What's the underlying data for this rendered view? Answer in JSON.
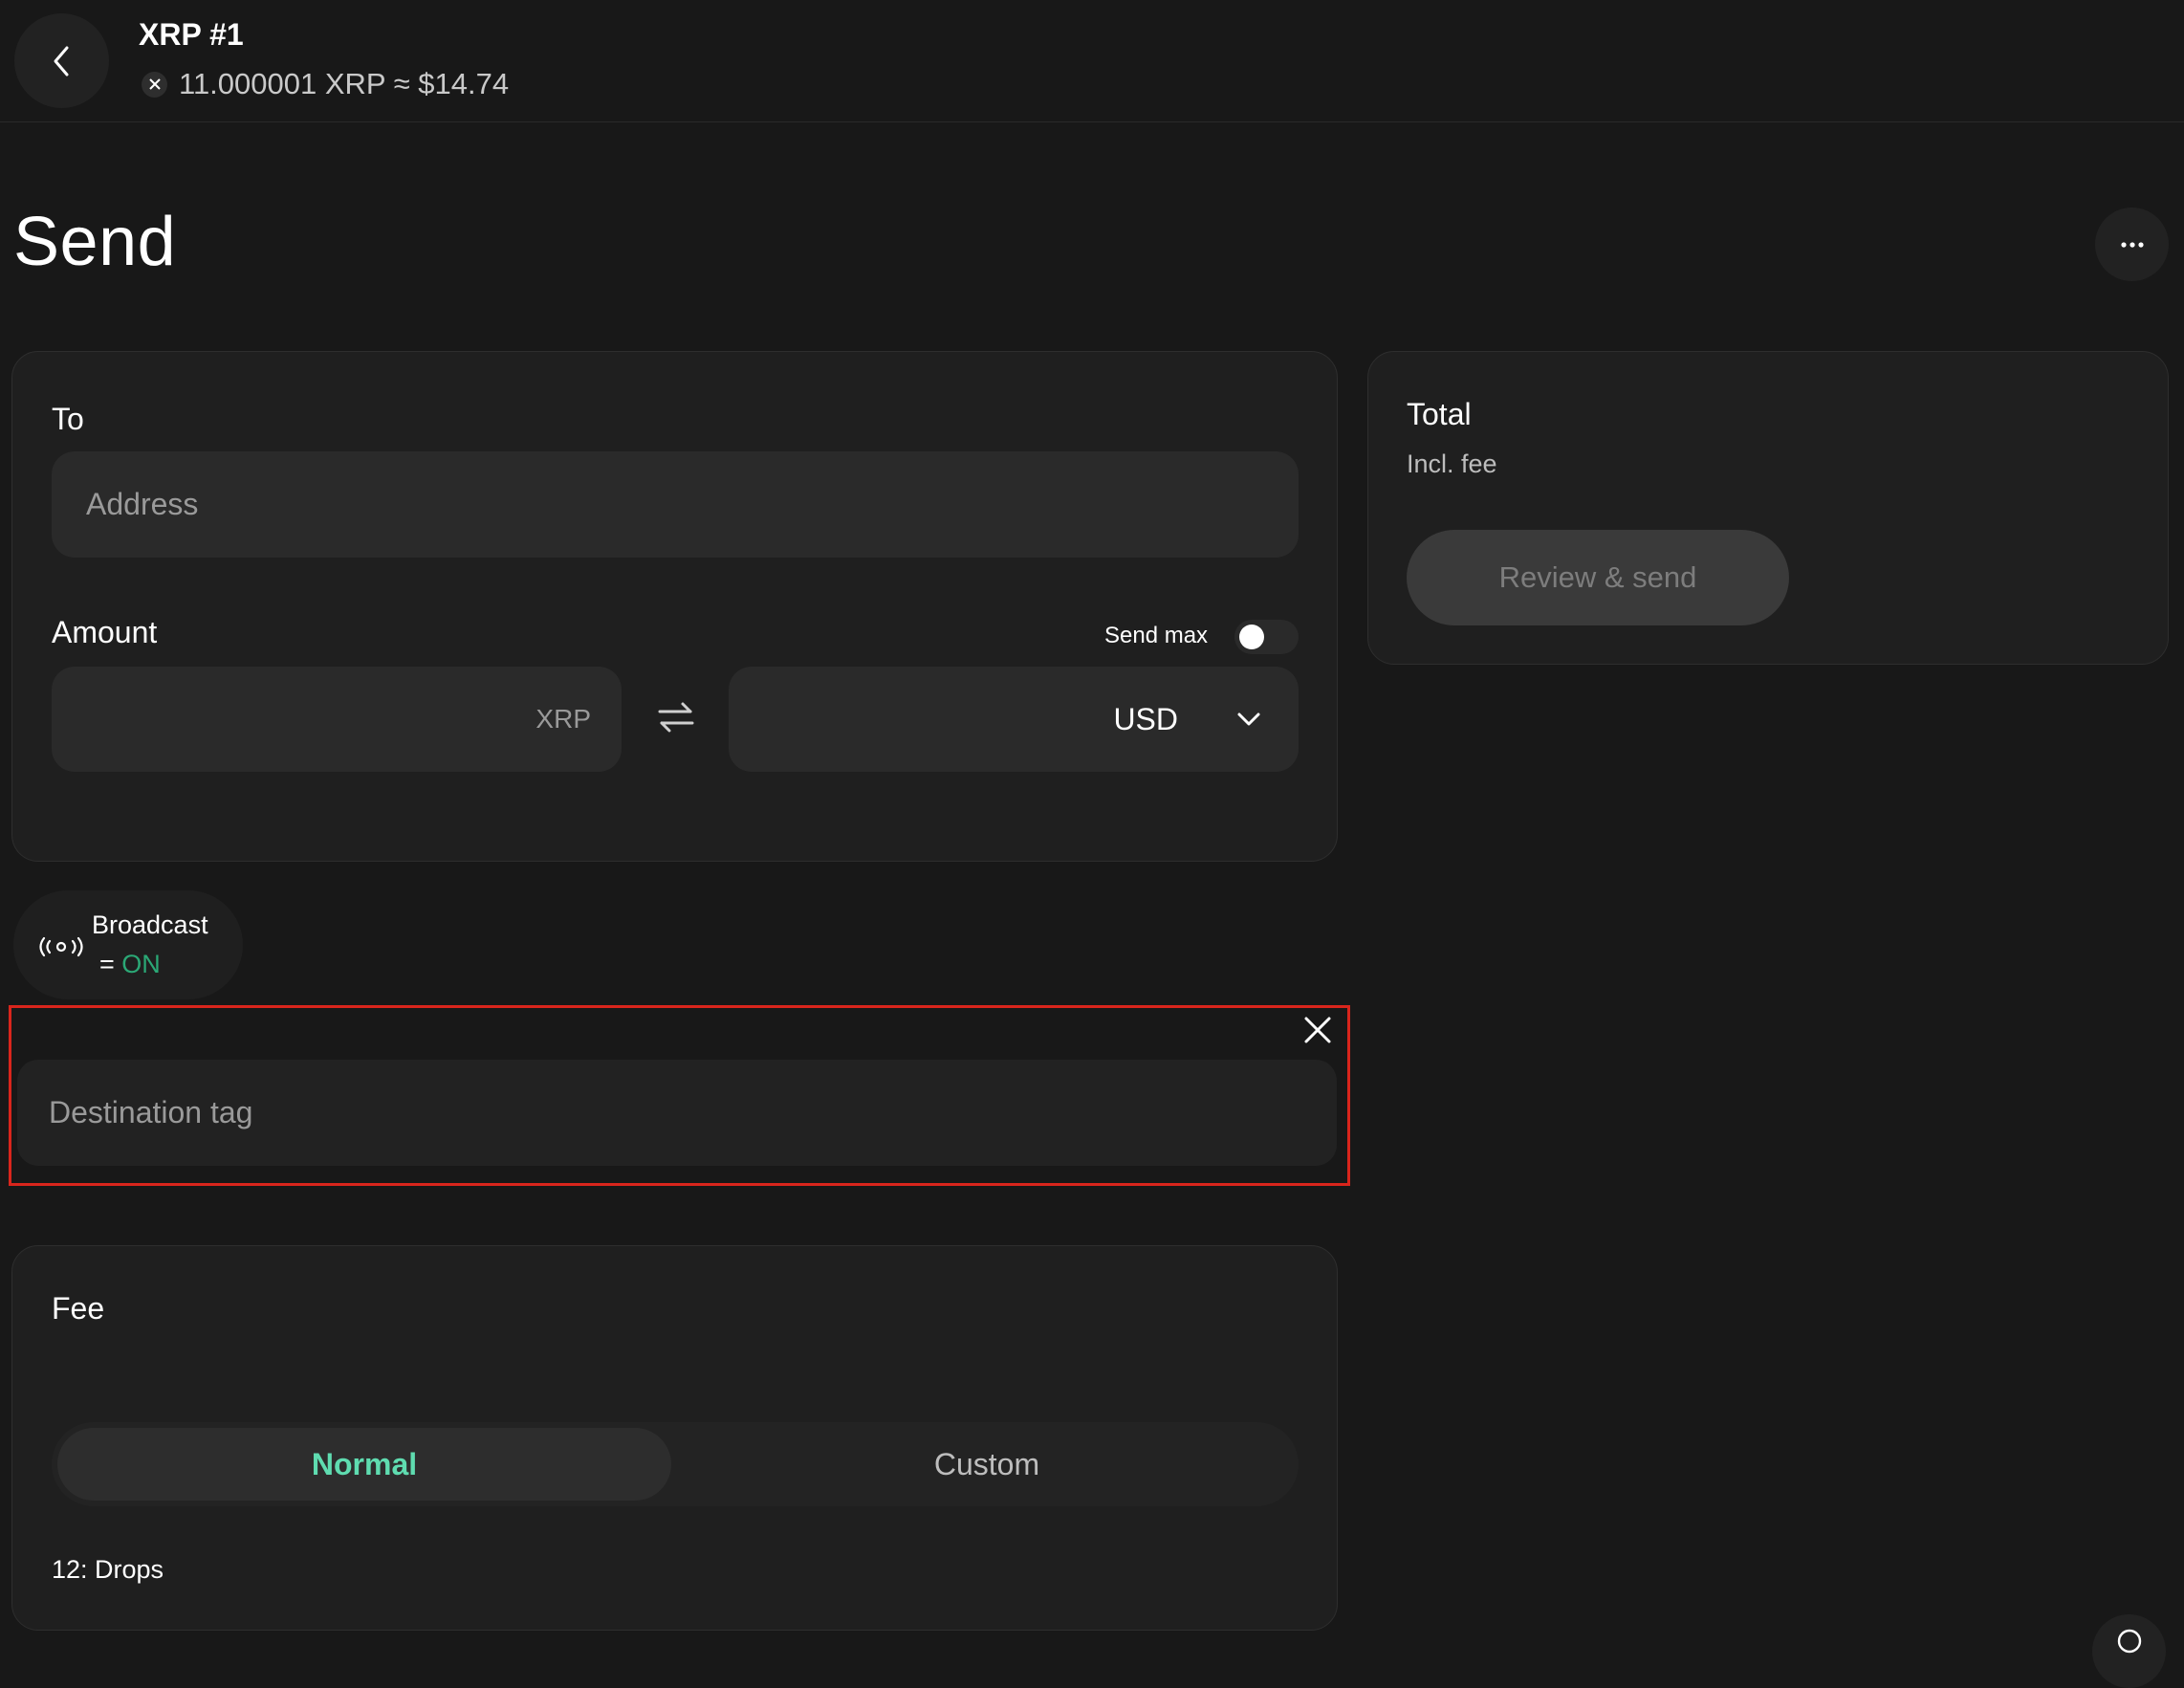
{
  "header": {
    "account_name": "XRP #1",
    "balance": "11.000001 XRP ≈ $14.74",
    "back_icon": "chevron-left-icon",
    "coin_icon": "xrp-icon"
  },
  "page": {
    "title": "Send",
    "more_icon": "more-horizontal-icon"
  },
  "send_form": {
    "to_label": "To",
    "address_placeholder": "Address",
    "amount_label": "Amount",
    "send_max_label": "Send max",
    "send_max_on": false,
    "crypto_unit": "XRP",
    "fiat_currency": "USD"
  },
  "total": {
    "label": "Total",
    "sublabel": "Incl. fee",
    "review_button": "Review & send"
  },
  "broadcast": {
    "title": "Broadcast",
    "prefix": "= ",
    "status": "ON"
  },
  "destination_tag": {
    "placeholder": "Destination tag"
  },
  "fee": {
    "label": "Fee",
    "options": [
      "Normal",
      "Custom"
    ],
    "selected": "Normal",
    "info": "12: Drops"
  },
  "colors": {
    "background": "#181818",
    "card": "#1f1f1f",
    "accent_green": "#5fdcb0",
    "status_green": "#2ba876",
    "highlight_red": "#d9251c"
  }
}
